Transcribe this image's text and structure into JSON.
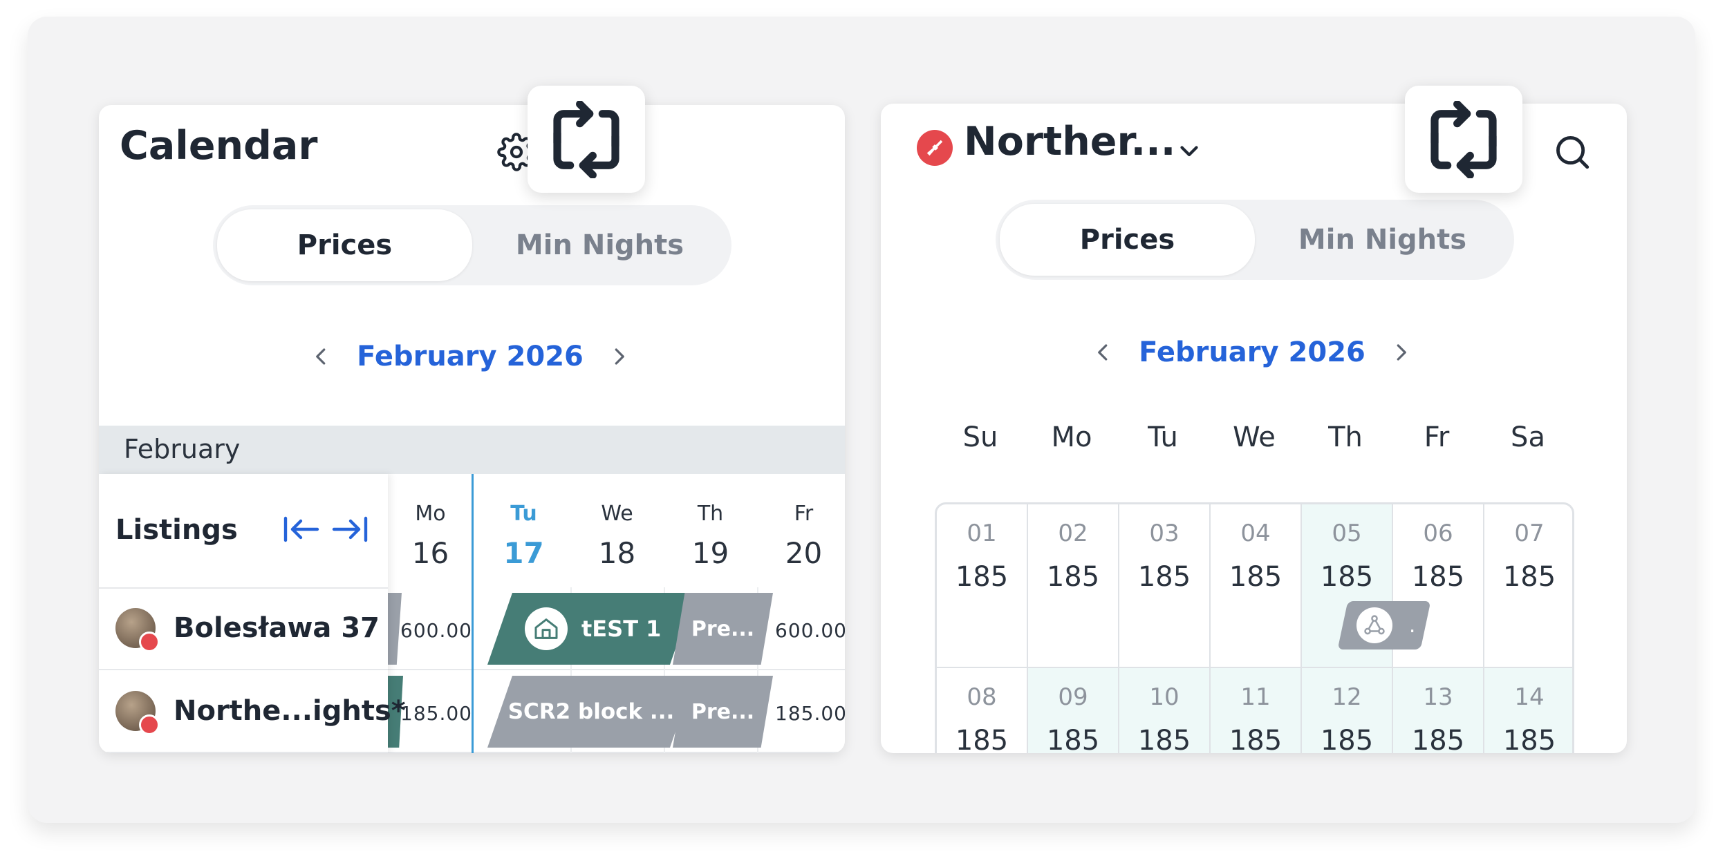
{
  "left_panel": {
    "title": "Calendar",
    "tabs": [
      "Prices",
      "Min Nights"
    ],
    "active_tab": "Prices",
    "month_label": "February 2026",
    "month_band": "February",
    "listings_label": "Listings",
    "days": [
      {
        "dow": "Mo",
        "num": "16"
      },
      {
        "dow": "Tu",
        "num": "17",
        "today": true
      },
      {
        "dow": "We",
        "num": "18"
      },
      {
        "dow": "Th",
        "num": "19"
      },
      {
        "dow": "Fr",
        "num": "20"
      }
    ],
    "listings": [
      {
        "name": "Bolesława 37",
        "price_left": "600.00",
        "price_right": "600.00",
        "booking": "tEST 1",
        "booking2": "Pre..."
      },
      {
        "name": "Northe...ights*",
        "price_left": "185.00",
        "price_right": "185.00",
        "booking": "SCR2 block ...",
        "booking2": "Pre..."
      }
    ],
    "colors": {
      "booking": "#467d76",
      "blocked": "#9aa0a9",
      "today": "#3b9bd6",
      "accent": "#2563d9"
    }
  },
  "right_panel": {
    "title": "Norther...",
    "tabs": [
      "Prices",
      "Min Nights"
    ],
    "active_tab": "Prices",
    "month_label": "February 2026",
    "weekdays": [
      "Su",
      "Mo",
      "Tu",
      "We",
      "Th",
      "Fr",
      "Sa"
    ],
    "cells": [
      {
        "d": "01",
        "v": "185"
      },
      {
        "d": "02",
        "v": "185"
      },
      {
        "d": "03",
        "v": "185"
      },
      {
        "d": "04",
        "v": "185"
      },
      {
        "d": "05",
        "v": "185",
        "hl": true
      },
      {
        "d": "06",
        "v": "185"
      },
      {
        "d": "07",
        "v": "185"
      },
      {
        "d": "08",
        "v": "185"
      },
      {
        "d": "09",
        "v": "185",
        "hl": true
      },
      {
        "d": "10",
        "v": "185",
        "hl": true
      },
      {
        "d": "11",
        "v": "185",
        "hl": true
      },
      {
        "d": "12",
        "v": "185",
        "hl": true
      },
      {
        "d": "13",
        "v": "185",
        "hl": true
      },
      {
        "d": "14",
        "v": "185",
        "hl": true
      }
    ],
    "tag_text": "."
  },
  "icons": [
    "repeat-icon",
    "gear-icon",
    "search-icon",
    "chevron-left-icon",
    "chevron-right-icon",
    "chevron-down-icon",
    "collapse-left-icon",
    "expand-right-icon",
    "home-icon",
    "broom-icon"
  ]
}
